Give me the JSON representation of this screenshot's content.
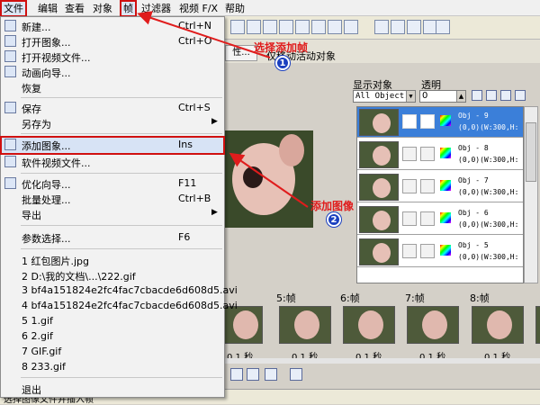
{
  "menubar": {
    "items": [
      "文件",
      "编辑",
      "查看",
      "对象",
      "帧",
      "过滤器",
      "视频 F/X",
      "帮助"
    ]
  },
  "top_panel": {
    "button_label": "性...",
    "active_object_label": "仅移动活动对象"
  },
  "file_menu": {
    "items": [
      {
        "label": "新建...",
        "shortcut": "Ctrl+N"
      },
      {
        "label": "打开图象...",
        "shortcut": "Ctrl+O"
      },
      {
        "label": "打开视频文件...",
        "shortcut": ""
      },
      {
        "label": "动画向导...",
        "shortcut": ""
      },
      {
        "label": "恢复",
        "shortcut": ""
      },
      {
        "label": "保存",
        "shortcut": "Ctrl+S"
      },
      {
        "label": "另存为",
        "shortcut": "",
        "submenu": "▶"
      },
      {
        "label": "添加图象...",
        "shortcut": "Ins"
      },
      {
        "label": "软件视频文件...",
        "shortcut": ""
      },
      {
        "label": "优化向导...",
        "shortcut": "F11"
      },
      {
        "label": "批量处理...",
        "shortcut": "Ctrl+B"
      },
      {
        "label": "导出",
        "shortcut": "",
        "submenu": "▶"
      },
      {
        "label": "参数选择...",
        "shortcut": "F6"
      },
      {
        "label": "1 红包图片.jpg",
        "shortcut": ""
      },
      {
        "label": "2 D:\\我的文档\\...\\222.gif",
        "shortcut": ""
      },
      {
        "label": "3 bf4a151824e2fc4fac7cbacde6d608d5.avi",
        "shortcut": ""
      },
      {
        "label": "4 bf4a151824e2fc4fac7cbacde6d608d5.avi",
        "shortcut": ""
      },
      {
        "label": "5 1.gif",
        "shortcut": ""
      },
      {
        "label": "6 2.gif",
        "shortcut": ""
      },
      {
        "label": "7 GIF.gif",
        "shortcut": ""
      },
      {
        "label": "8 233.gif",
        "shortcut": ""
      },
      {
        "label": "退出",
        "shortcut": ""
      }
    ]
  },
  "annotations": {
    "step1_text": "选择添加帧",
    "step1_number": "1",
    "step2_text": "添加图像",
    "step2_number": "2"
  },
  "right_panel": {
    "display_objects_label": "显示对象",
    "transparency_label": "透明",
    "display_objects_value": "All Object",
    "transparency_value": "0",
    "objects": [
      {
        "name": "Obj - 9",
        "info": "(0,0)(W:300,H:"
      },
      {
        "name": "Obj - 8",
        "info": "(0,0)(W:300,H:"
      },
      {
        "name": "Obj - 7",
        "info": "(0,0)(W:300,H:"
      },
      {
        "name": "Obj - 6",
        "info": "(0,0)(W:300,H:"
      },
      {
        "name": "Obj - 5",
        "info": "(0,0)(W:300,H:"
      }
    ]
  },
  "frames": {
    "labels": [
      "5:帧",
      "6:帧",
      "7:帧",
      "8:帧"
    ],
    "times": [
      "0.1 秒",
      "0.1 秒",
      "0.1 秒",
      "0.1 秒",
      "0.1 秒",
      "0.1 秒"
    ]
  },
  "status_text": "选择图像文件并插入帧"
}
